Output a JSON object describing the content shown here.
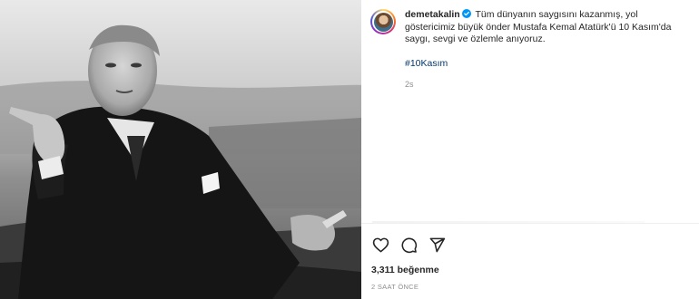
{
  "post": {
    "author": {
      "username": "demetakalin",
      "avatar_icon": "profile-avatar",
      "verified": true,
      "verified_color": "#0095f6"
    },
    "caption": "Tüm dünyanın saygısını kazanmış, yol göstericimiz büyük önder Mustafa Kemal Atatürk'ü 10 Kasım'da saygı, sevgi ve özlemle anıyoruz.",
    "hashtag": "#10Kasım",
    "time_ago": "2s",
    "actions": [
      {
        "name": "like",
        "icon": "heart-icon"
      },
      {
        "name": "comment",
        "icon": "comment-icon"
      },
      {
        "name": "share",
        "icon": "share-icon"
      }
    ],
    "likes_text": "3,311 beğenme",
    "posted_text": "2 SAAT ÖNCE"
  },
  "colors": {
    "link": "#00376b",
    "secondary_text": "#8e8e8e",
    "primary_text": "#262626"
  }
}
